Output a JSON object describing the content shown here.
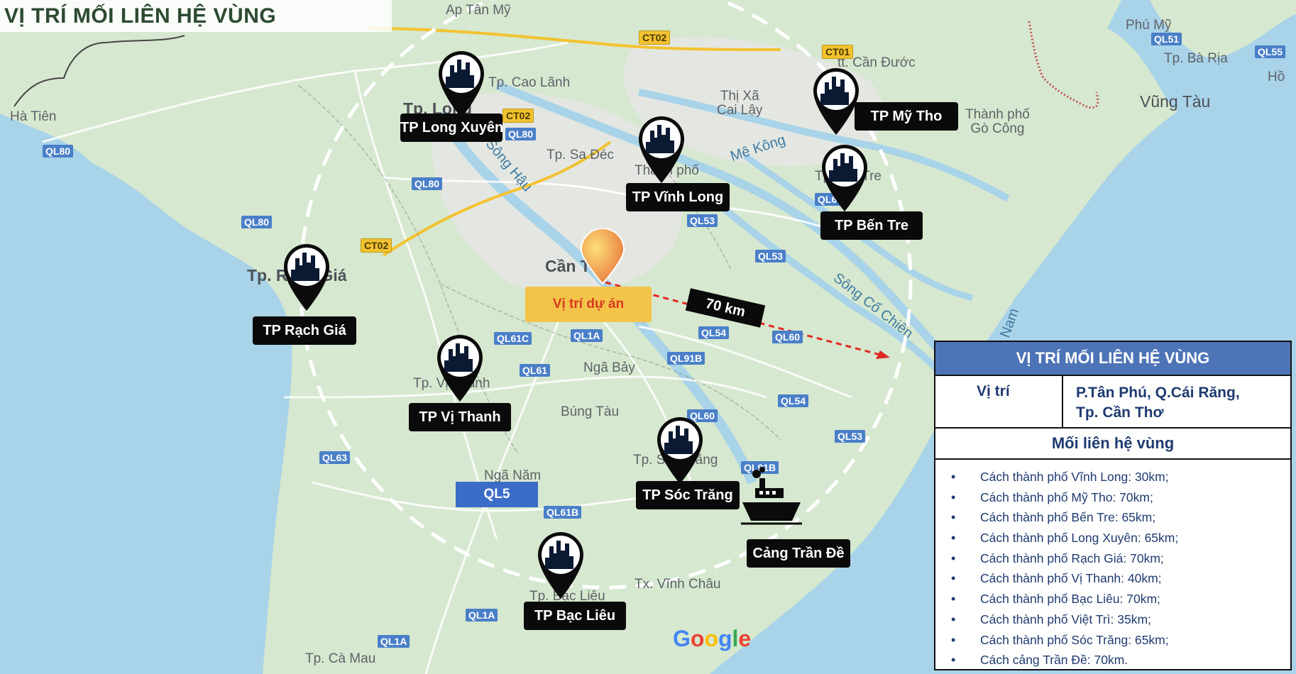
{
  "title": "VỊ TRÍ MỐI LIÊN HỆ VÙNG",
  "place_labels": {
    "ap_tan_my": "Ap Tân Mỹ",
    "ha_tien": "Hà Tiên",
    "tp_cao_lanh": "Tp. Cao Lãnh",
    "tp_long": "Tp. Long",
    "tp_sa_dec": "Tp. Sa Đéc",
    "thi_xa_cai_lay": "Thị Xã\nCai Lậy",
    "tt_can_duoc": "tt. Cần Đước",
    "phu_my": "Phú Mỹ",
    "tp_ba_ria": "Tp. Bà Rịa",
    "vung_tau": "Vũng Tàu",
    "thanh_pho_go_cong": "Thành phố\nGò Công",
    "thanh_pho_vinh_long": "Thành phố",
    "tp_ben_tre": "Tp.Bến Tre",
    "can_tho": "Cần Thơ",
    "tp_rach_gia": "Tp. Rạch Giá",
    "nga_bay": "Ngã Bảy",
    "bung_tau": "Búng Tàu",
    "tp_vi_thanh": "Tp. Vị Thanh",
    "tp_soc_trang": "Tp. Sóc Trăng",
    "nga_nam": "Ngã Năm",
    "tp_bac_lieu": "Tp. Bạc Liêu",
    "tx_vinh_chau": "Tx. Vĩnh Châu",
    "tp_ca_mau": "Tp. Cà Mau",
    "me_kong": "Mê Kông",
    "song_hau": "Sông Hậu",
    "song_co_chien": "Sông Cổ Chiên",
    "nam": "Nam",
    "ho": "Hồ"
  },
  "road_labels": {
    "ct02_a": "CT02",
    "ct01": "CT01",
    "ql51": "QL51",
    "ql55": "QL55",
    "ql80_a": "QL80",
    "ct02_b": "CT02",
    "ql80_b": "QL80",
    "ql80_c": "QL80",
    "ql80_d": "QL80",
    "ct02_c": "CT02",
    "ql60_a": "QL60",
    "ql53_a": "QL53",
    "ql53_b": "QL53",
    "ql54_a": "QL54",
    "ql60_b": "QL60",
    "ql61c": "QL61C",
    "ql1a_a": "QL1A",
    "ql61": "QL61",
    "ql91b": "QL91B",
    "ql60_c": "QL60",
    "ql54_b": "QL54",
    "ql53_c": "QL53",
    "ql63": "QL63",
    "ql61b": "QL61B",
    "ql91b_b": "QL91B",
    "ql1a_b": "QL1A",
    "ql1a_c": "QL1A"
  },
  "city_labels": {
    "long_xuyen": "TP Long Xuyên",
    "my_tho": "TP Mỹ Tho",
    "vinh_long": "TP Vĩnh Long",
    "ben_tre": "TP Bến Tre",
    "rach_gia": "TP Rạch Giá",
    "vi_thanh": "TP Vị Thanh",
    "soc_trang": "TP Sóc Trăng",
    "bac_lieu": "TP Bạc Liêu",
    "cang_tran_de": "Cảng Trần Đề"
  },
  "project_label": "Vị trí dự án",
  "distance_label": "70 km",
  "ql5_label": "QL5",
  "google_logo": "Google",
  "colors": {
    "land": "#d8ead1",
    "urban": "#e9ece6",
    "water": "#a8d3e9",
    "title_text": "#2c4a32",
    "panel_header": "#4e74b8",
    "panel_text": "#1f3b70",
    "project_fill": "#f4c34a",
    "project_text": "#d63a1e",
    "distance_arrow": "#e02b24",
    "radius_circle": "#ffffff"
  },
  "info_panel": {
    "header": "VỊ TRÍ MỐI LIÊN HỆ VÙNG",
    "location_key": "Vị trí",
    "location_value_1": "P.Tân Phú, Q.Cái Răng,",
    "location_value_2": "Tp. Cần Thơ",
    "subheader": "Mối liên hệ vùng",
    "items": [
      "Cách thành phố Vĩnh Long: 30km;",
      "Cách thành phố Mỹ Tho: 70km;",
      "Cách thành phố Bến Tre: 65km;",
      "Cách thành phố Long Xuyên: 65km;",
      "Cách thành phố Rạch Giá: 70km;",
      "Cách thành phố Vị Thanh: 40km;",
      "Cách thành phố Bạc Liêu: 70km;",
      "Cách thành phố Việt Trì: 35km;",
      "Cách thành phố Sóc Trăng: 65km;",
      "Cách cảng Trần Đề: 70km."
    ]
  },
  "icons": {
    "city_marker": "city-skyline-pin-icon",
    "project_marker": "orange-location-pin-icon",
    "port_marker": "cargo-ship-icon"
  }
}
